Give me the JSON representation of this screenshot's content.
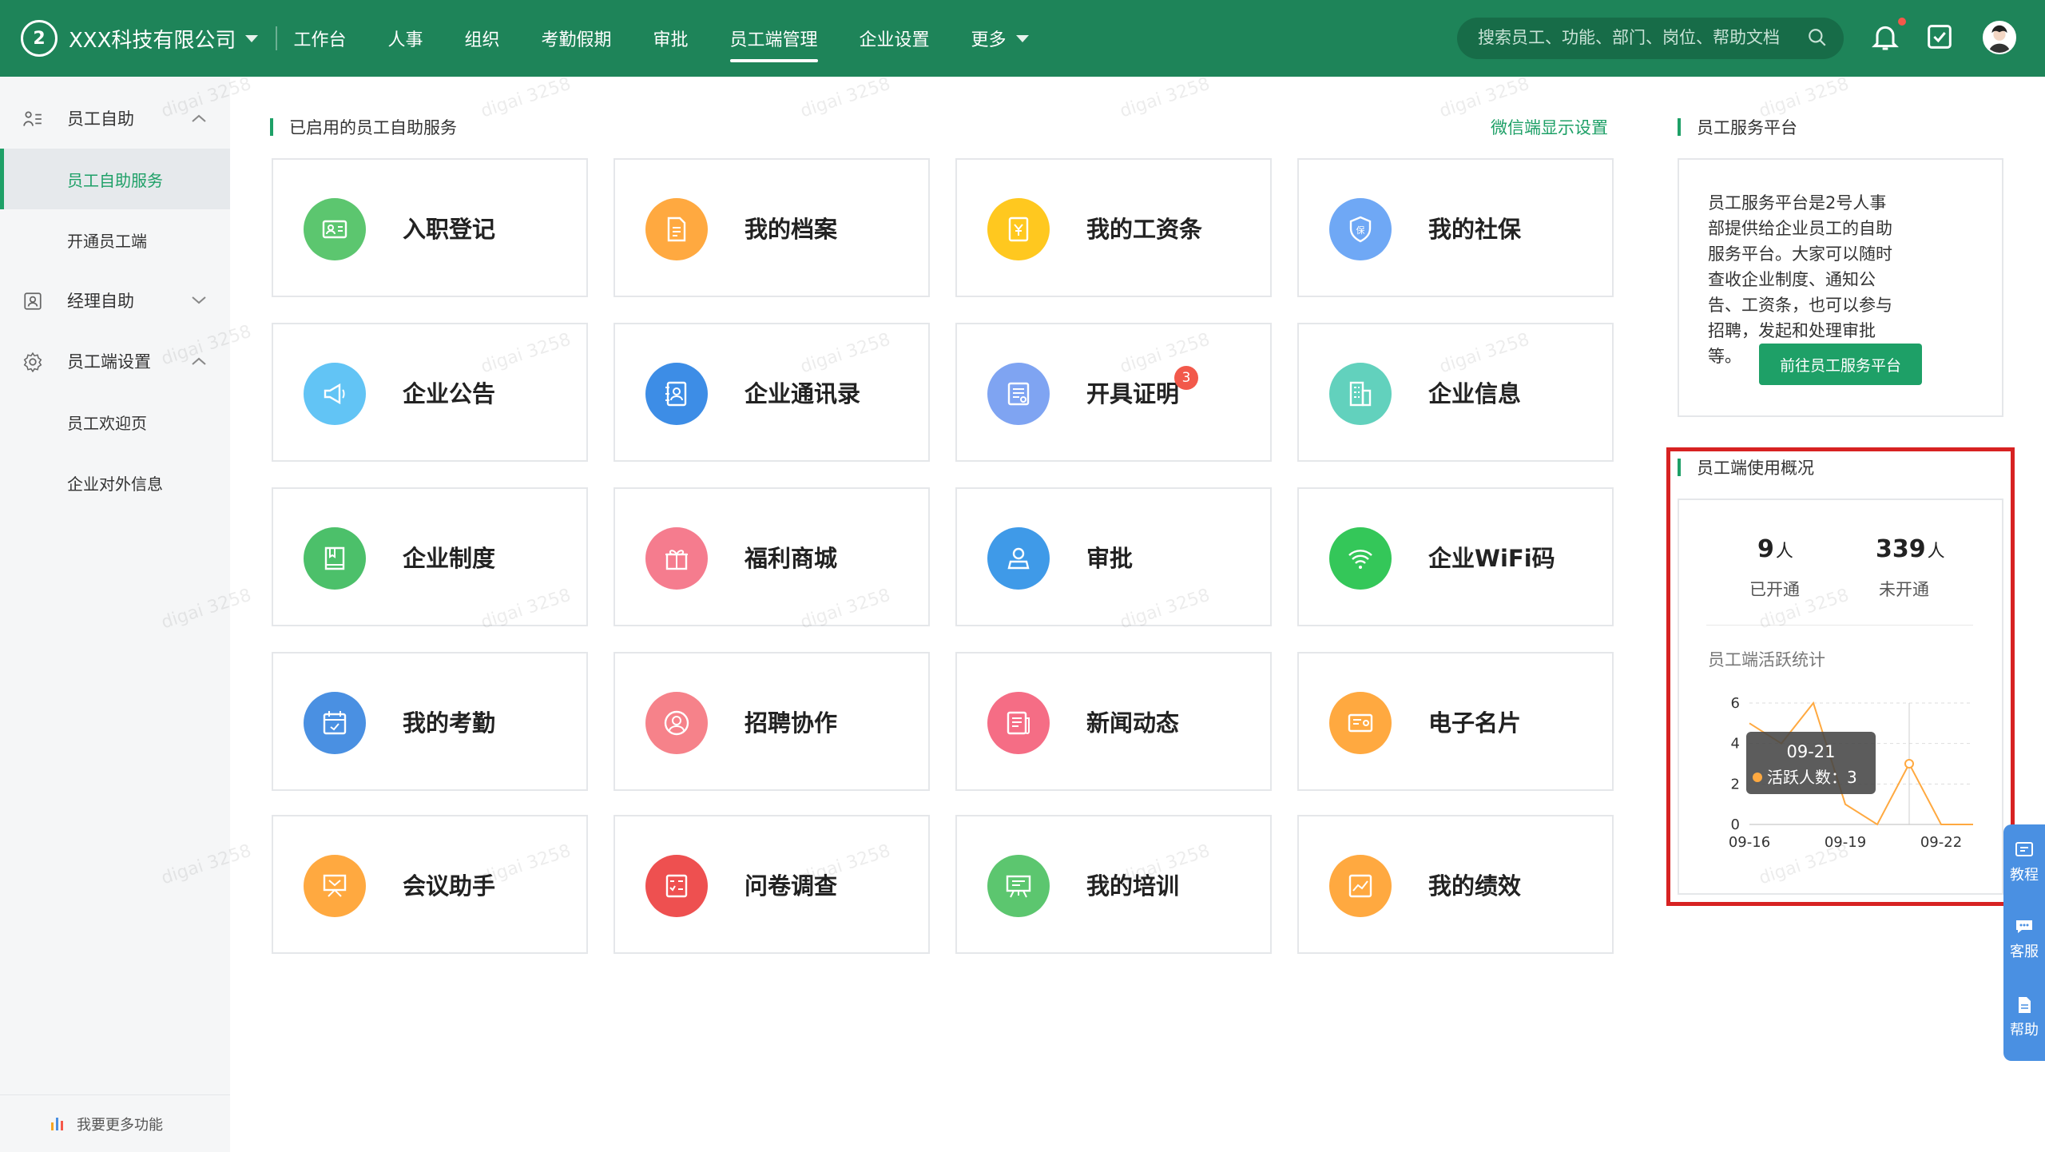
{
  "topbar": {
    "company": "XXX科技有限公司",
    "logo_text": "2",
    "nav": [
      "工作台",
      "人事",
      "组织",
      "考勤假期",
      "审批",
      "员工端管理",
      "企业设置",
      "更多"
    ],
    "active_nav": "员工端管理",
    "search_placeholder": "搜索员工、功能、部门、岗位、帮助文档"
  },
  "sidebar": {
    "groups": [
      {
        "label": "员工自助",
        "icon": "list-icon",
        "expanded": true,
        "items": [
          "员工自助服务",
          "开通员工端"
        ]
      },
      {
        "label": "经理自助",
        "icon": "manager-icon",
        "expanded": false,
        "items": []
      },
      {
        "label": "员工端设置",
        "icon": "gear-icon",
        "expanded": true,
        "items": [
          "员工欢迎页",
          "企业对外信息"
        ]
      }
    ],
    "active_item": "员工自助服务",
    "bottom": "我要更多功能"
  },
  "main": {
    "section_title": "已启用的员工自助服务",
    "settings_link": "微信端显示设置",
    "services": [
      {
        "name": "入职登记",
        "icon": "id-card-icon",
        "color": "#5cc66f"
      },
      {
        "name": "我的档案",
        "icon": "document-icon",
        "color": "#ffa940"
      },
      {
        "name": "我的工资条",
        "icon": "payslip-icon",
        "color": "#ffc81f"
      },
      {
        "name": "我的社保",
        "icon": "shield-icon",
        "color": "#6fa8f5"
      },
      {
        "name": "企业公告",
        "icon": "megaphone-icon",
        "color": "#62c4f5"
      },
      {
        "name": "企业通讯录",
        "icon": "contacts-icon",
        "color": "#3d8de6"
      },
      {
        "name": "开具证明",
        "icon": "certificate-icon",
        "color": "#7fa4f2",
        "badge": "3"
      },
      {
        "name": "企业信息",
        "icon": "building-icon",
        "color": "#62d1bd"
      },
      {
        "name": "企业制度",
        "icon": "book-icon",
        "color": "#4cc06a"
      },
      {
        "name": "福利商城",
        "icon": "gift-icon",
        "color": "#f57c8e"
      },
      {
        "name": "审批",
        "icon": "approval-icon",
        "color": "#3f9ae8"
      },
      {
        "name": "企业WiFi码",
        "icon": "wifi-icon",
        "color": "#34c759"
      },
      {
        "name": "我的考勤",
        "icon": "calendar-icon",
        "color": "#4a90e2"
      },
      {
        "name": "招聘协作",
        "icon": "user-circle-icon",
        "color": "#f6828a"
      },
      {
        "name": "新闻动态",
        "icon": "news-icon",
        "color": "#f56d85"
      },
      {
        "name": "电子名片",
        "icon": "card-icon",
        "color": "#ffa940"
      },
      {
        "name": "会议助手",
        "icon": "meeting-icon",
        "color": "#ffa940"
      },
      {
        "name": "问卷调查",
        "icon": "survey-icon",
        "color": "#ee5050"
      },
      {
        "name": "我的培训",
        "icon": "training-icon",
        "color": "#5cc66f"
      },
      {
        "name": "我的绩效",
        "icon": "performance-icon",
        "color": "#ffa940"
      }
    ]
  },
  "right": {
    "platform_title": "员工服务平台",
    "platform_desc": "员工服务平台是2号人事部提供给企业员工的自助服务平台。大家可以随时查收企业制度、通知公告、工资条，也可以参与招聘，发起和处理审批等。",
    "platform_button": "前往员工服务平台",
    "usage_title": "员工端使用概况",
    "opened_count": "9",
    "opened_unit": "人",
    "opened_label": "已开通",
    "unopened_count": "339",
    "unopened_unit": "人",
    "unopened_label": "未开通",
    "chart_title": "员工端活跃统计"
  },
  "chart_data": {
    "type": "line",
    "title": "员工端活跃统计",
    "x": [
      "09-16",
      "09-17",
      "09-18",
      "09-19",
      "09-20",
      "09-21",
      "09-22",
      "09-23"
    ],
    "xticks": [
      "09-16",
      "09-19",
      "09-22"
    ],
    "yticks": [
      "0",
      "2",
      "4",
      "6"
    ],
    "ylim": [
      0,
      6
    ],
    "series": [
      {
        "values": [
          5,
          4,
          6,
          1,
          0,
          3,
          0,
          0
        ],
        "color": "#ffa940"
      }
    ],
    "tooltip": {
      "date": "09-21",
      "label": "活跃人数：3"
    }
  },
  "float_bar": [
    "教程",
    "客服",
    "帮助"
  ],
  "watermark": "digai 3258"
}
